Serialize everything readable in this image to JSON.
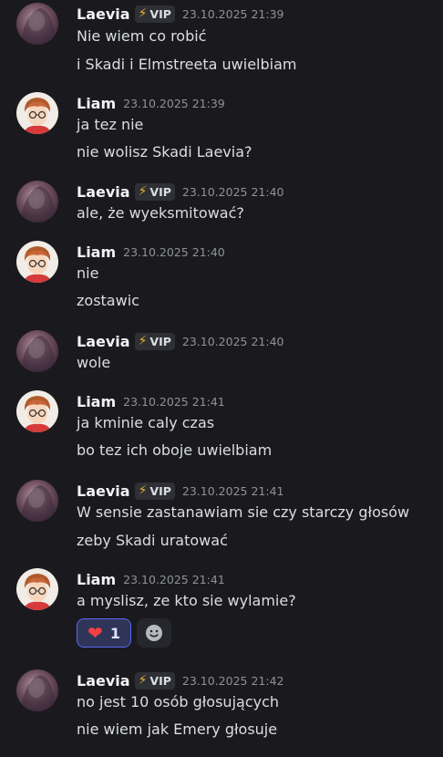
{
  "messages": [
    {
      "author": "Laevia",
      "vip": true,
      "badge": "VIP",
      "timestamp": "23.10.2025 21:39",
      "lines": [
        "Nie wiem co robić",
        "i Skadi i Elmstreeta uwielbiam"
      ]
    },
    {
      "author": "Liam",
      "vip": false,
      "timestamp": "23.10.2025 21:39",
      "lines": [
        "ja tez nie",
        "nie wolisz Skadi Laevia?"
      ]
    },
    {
      "author": "Laevia",
      "vip": true,
      "badge": "VIP",
      "timestamp": "23.10.2025 21:40",
      "lines": [
        "ale, że wyeksmitować?"
      ]
    },
    {
      "author": "Liam",
      "vip": false,
      "timestamp": "23.10.2025 21:40",
      "lines": [
        "nie",
        "zostawic"
      ]
    },
    {
      "author": "Laevia",
      "vip": true,
      "badge": "VIP",
      "timestamp": "23.10.2025 21:40",
      "lines": [
        "wole"
      ]
    },
    {
      "author": "Liam",
      "vip": false,
      "timestamp": "23.10.2025 21:41",
      "lines": [
        "ja kminie caly czas",
        "bo tez ich oboje uwielbiam"
      ]
    },
    {
      "author": "Laevia",
      "vip": true,
      "badge": "VIP",
      "timestamp": "23.10.2025 21:41",
      "lines": [
        "W sensie zastanawiam sie czy starczy głosów",
        "zeby Skadi uratować"
      ]
    },
    {
      "author": "Liam",
      "vip": false,
      "timestamp": "23.10.2025 21:41",
      "lines": [
        "a myslisz, ze kto sie wylamie?"
      ],
      "reaction": {
        "emoji": "heart",
        "count": "1"
      }
    },
    {
      "author": "Laevia",
      "vip": true,
      "badge": "VIP",
      "timestamp": "23.10.2025 21:42",
      "lines": [
        "no jest 10 osób głosujących",
        "nie wiem jak Emery głosuje"
      ]
    }
  ],
  "colors": {
    "background": "#1a1a1e",
    "vip_bolt": "#f0b232",
    "reaction_border": "#5865f2",
    "heart": "#f23f43"
  },
  "icons": {
    "vip": "lightning-bolt-icon",
    "reaction": "red-heart-icon",
    "add_reaction": "smiley-icon"
  }
}
